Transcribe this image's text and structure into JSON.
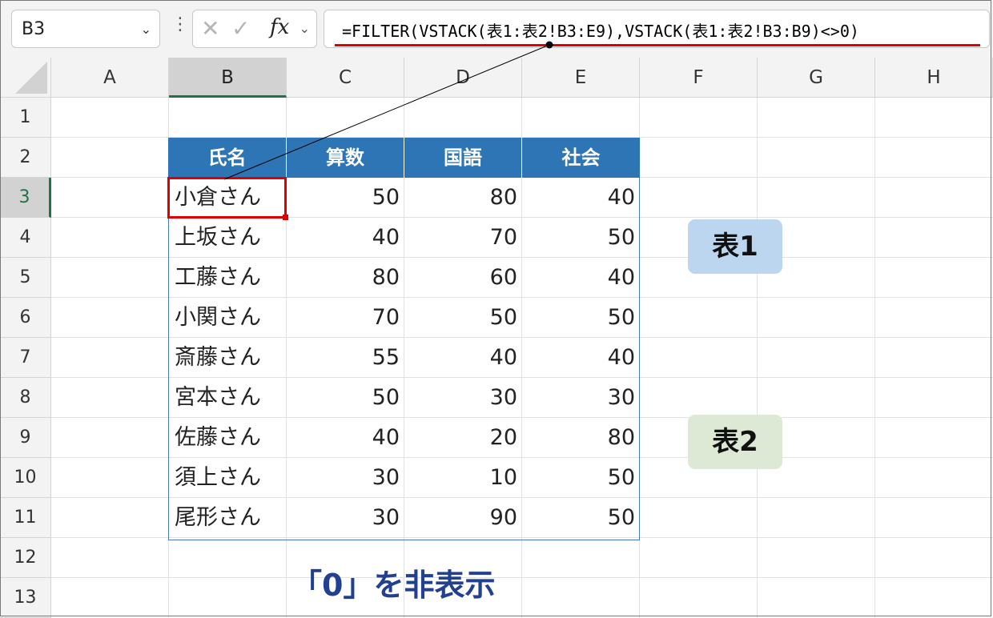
{
  "formula_bar": {
    "name_box": "B3",
    "formula": "=FILTER(VSTACK(表1:表2!B3:E9),VSTACK(表1:表2!B3:B9)<>0)",
    "fx_label": "fx"
  },
  "columns": [
    "A",
    "B",
    "C",
    "D",
    "E",
    "F",
    "G",
    "H"
  ],
  "rows": [
    "1",
    "2",
    "3",
    "4",
    "5",
    "6",
    "7",
    "8",
    "9",
    "10",
    "11",
    "12",
    "13"
  ],
  "table": {
    "headers": [
      "氏名",
      "算数",
      "国語",
      "社会"
    ],
    "rows": [
      [
        "小倉さん",
        "50",
        "80",
        "40"
      ],
      [
        "上坂さん",
        "40",
        "70",
        "50"
      ],
      [
        "工藤さん",
        "80",
        "60",
        "40"
      ],
      [
        "小関さん",
        "70",
        "50",
        "50"
      ],
      [
        "斎藤さん",
        "55",
        "40",
        "40"
      ],
      [
        "宮本さん",
        "50",
        "30",
        "30"
      ],
      [
        "佐藤さん",
        "40",
        "20",
        "80"
      ],
      [
        "須上さん",
        "30",
        "10",
        "50"
      ],
      [
        "尾形さん",
        "30",
        "90",
        "50"
      ]
    ]
  },
  "labels": {
    "table1": "表1",
    "table2": "表2",
    "caption": "「0」を非表示"
  },
  "colors": {
    "header_fill": "#2e75b6",
    "highlight": "#e00000",
    "caption": "#21408f"
  }
}
